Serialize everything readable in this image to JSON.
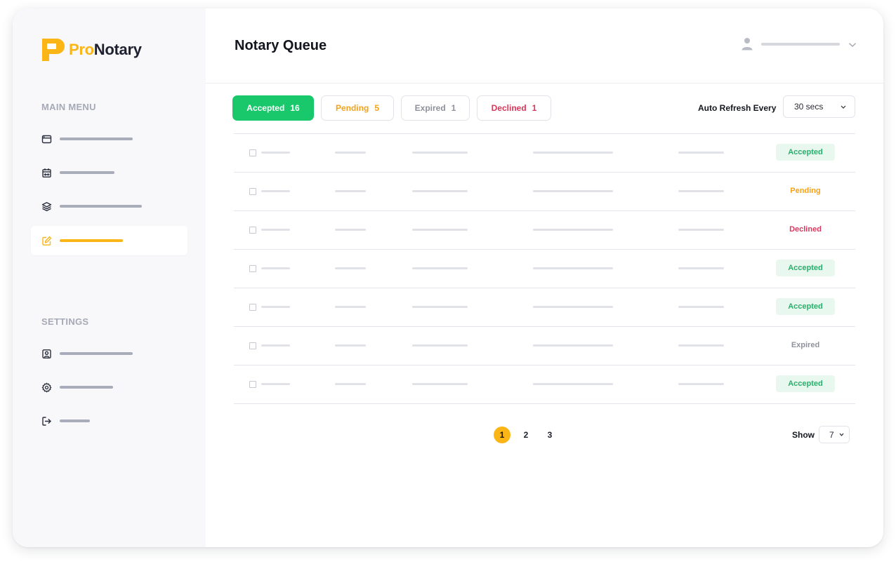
{
  "brand": {
    "name_part1": "Pro",
    "name_part2": "Notary",
    "accent": "#fbb516"
  },
  "sidebar": {
    "main_menu_label": "MAIN MENU",
    "settings_label": "SETTINGS",
    "main_items": [
      {
        "icon": "browser-window-icon"
      },
      {
        "icon": "calendar-icon"
      },
      {
        "icon": "layers-icon"
      },
      {
        "icon": "edit-icon",
        "active": true
      }
    ],
    "settings_items": [
      {
        "icon": "user-profile-icon"
      },
      {
        "icon": "gear-icon"
      },
      {
        "icon": "logout-icon"
      }
    ]
  },
  "header": {
    "title": "Notary Queue",
    "user_icon": "user-icon"
  },
  "tabs": [
    {
      "label": "Accepted",
      "count": "16",
      "color": "#19c86b"
    },
    {
      "label": "Pending",
      "count": "5",
      "color": "#f5a21b"
    },
    {
      "label": "Expired",
      "count": "1",
      "color": "#8e919c"
    },
    {
      "label": "Declined",
      "count": "1",
      "color": "#dc3459"
    }
  ],
  "auto_refresh": {
    "label": "Auto Refresh Every",
    "value": "30 secs"
  },
  "table": {
    "rows": [
      {
        "status": "Accepted"
      },
      {
        "status": "Pending"
      },
      {
        "status": "Declined"
      },
      {
        "status": "Accepted"
      },
      {
        "status": "Accepted"
      },
      {
        "status": "Expired"
      },
      {
        "status": "Accepted"
      }
    ]
  },
  "pagination": {
    "pages": [
      "1",
      "2",
      "3"
    ],
    "current": "1"
  },
  "show": {
    "label": "Show",
    "value": "7"
  }
}
